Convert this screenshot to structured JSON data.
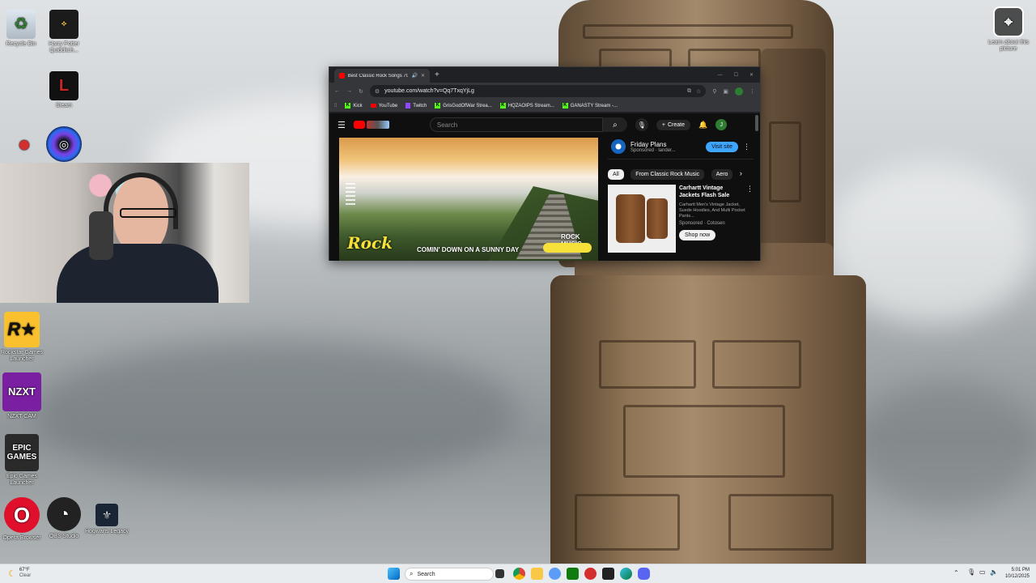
{
  "desktop": {
    "icons": [
      {
        "label": "Recycle Bin"
      },
      {
        "label": "Harry Potter Quidditch..."
      },
      {
        "label": "Steam"
      },
      {
        "label": "Ubisoft Connect"
      },
      {
        "label": "Rockstar Games Launcher"
      },
      {
        "label": "NZXT CAM"
      },
      {
        "label": "Epic Games Launcher"
      },
      {
        "label": "Opera Browser"
      },
      {
        "label": "OBS Studio"
      },
      {
        "label": "Hogwarts Legacy"
      }
    ],
    "learn_about": "Learn about this picture"
  },
  "browser": {
    "tab_title": "Best Classic Rock Songs 70s",
    "new_tab": "+",
    "url": "youtube.com/watch?v=Qq7TxqYjLg",
    "bookmarks": [
      "Kick",
      "YouTube",
      "Twitch",
      "GrisGodOfWar Strea...",
      "HQZAOIPS Stream...",
      "GANASTY Stream -..."
    ],
    "youtube": {
      "search_placeholder": "Search",
      "create_label": "Create",
      "avatar_letter": "J",
      "video_caption": "COMIN' DOWN ON A SUNNY DAY",
      "video_logo": "Rock",
      "video_badge": "ROCK MUSIC",
      "ad_title": "Friday Plans",
      "ad_sponsor": "Sponsored · lander...",
      "ad_button": "Visit site",
      "chips": [
        "All",
        "From Classic Rock Music",
        "Aero"
      ],
      "product_title": "Carhartt Vintage Jackets Flash Sale",
      "product_desc": "Carhartt Men's Vintage Jacket, Suede Hoodies, And Multi Pocket Pants...",
      "product_sponsor": "Sponsored · Cotosen",
      "product_button": "Shop now"
    }
  },
  "taskbar": {
    "weather_temp": "67°F",
    "weather_desc": "Clear",
    "search_label": "Search",
    "time": "5:01 PM",
    "date": "10/12/2025"
  }
}
